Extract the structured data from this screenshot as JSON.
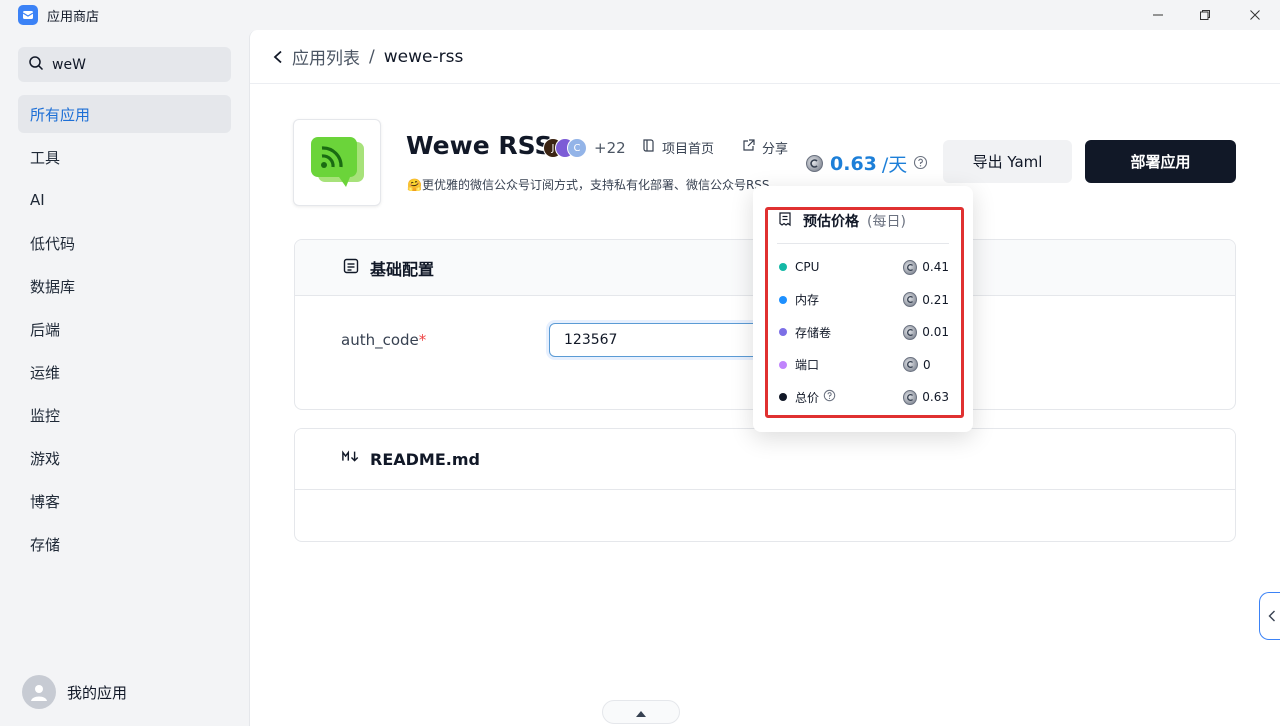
{
  "window": {
    "title": "应用商店"
  },
  "sidebar": {
    "search_value": "weW",
    "items": [
      {
        "label": "所有应用",
        "active": true
      },
      {
        "label": "工具"
      },
      {
        "label": "AI"
      },
      {
        "label": "低代码"
      },
      {
        "label": "数据库"
      },
      {
        "label": "后端"
      },
      {
        "label": "运维"
      },
      {
        "label": "监控"
      },
      {
        "label": "游戏"
      },
      {
        "label": "博客"
      },
      {
        "label": "存储"
      }
    ],
    "user_label": "我的应用"
  },
  "breadcrumb": {
    "parent": "应用列表",
    "separator": "/",
    "current": "wewe-rss"
  },
  "app": {
    "name": "Wewe RSS",
    "contributors": [
      {
        "initial": "J",
        "color": "#3b2413"
      },
      {
        "initial": "",
        "color": "#7c5cd6"
      },
      {
        "initial": "C",
        "color": "#93b4e8"
      }
    ],
    "contributors_more": "+22",
    "homepage_label": "项目首页",
    "share_label": "分享",
    "description": "🤗更优雅的微信公众号订阅方式，支持私有化部署、微信公众号RSS"
  },
  "price": {
    "value": "0.63",
    "unit": "/天"
  },
  "buttons": {
    "export": "导出 Yaml",
    "deploy": "部署应用"
  },
  "config_section": {
    "title": "基础配置",
    "field_label": "auth_code",
    "required_mark": "*",
    "field_value": "123567"
  },
  "readme_section": {
    "title": "README.md"
  },
  "price_popover": {
    "title": "预估价格",
    "subtitle": "(每日)",
    "rows": [
      {
        "label": "CPU",
        "value": "0.41",
        "color": "#14b8a6"
      },
      {
        "label": "内存",
        "value": "0.21",
        "color": "#1e90ff"
      },
      {
        "label": "存储卷",
        "value": "0.01",
        "color": "#7c6fe6"
      },
      {
        "label": "端口",
        "value": "0",
        "color": "#c084fc"
      },
      {
        "label": "总价",
        "value": "0.63",
        "color": "#111827"
      }
    ]
  },
  "colors": {
    "accent": "#1d7fd8",
    "primary_button": "#111827",
    "highlight_border": "#e03131"
  },
  "icons": [
    "app-logo-icon",
    "search-icon",
    "back-chevron-icon",
    "rss-app-icon",
    "book-icon",
    "share-icon",
    "coin-icon",
    "help-icon",
    "document-icon",
    "markdown-icon",
    "receipt-icon",
    "user-avatar-icon",
    "chevron-up-icon",
    "chevron-left-icon"
  ]
}
